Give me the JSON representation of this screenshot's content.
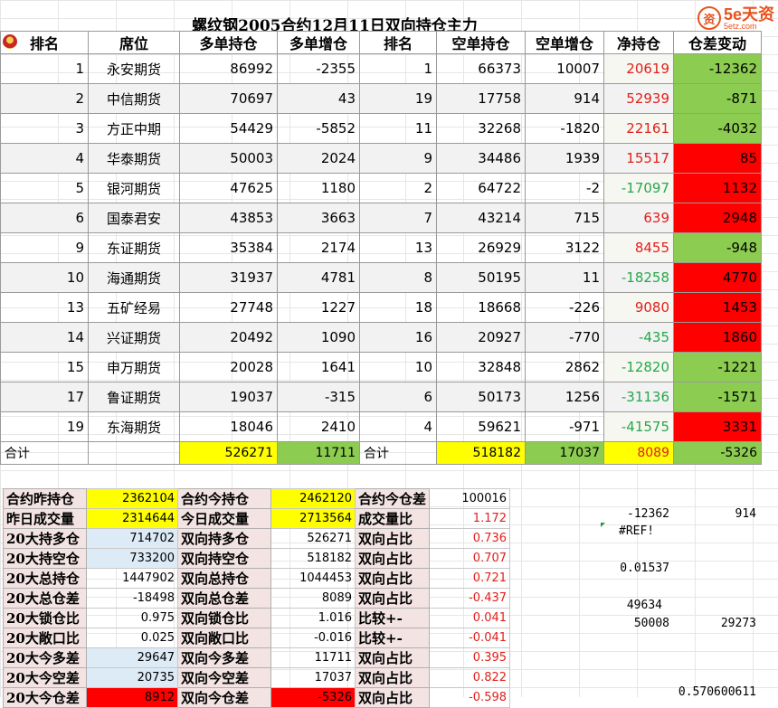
{
  "title": "螺纹钢2005合约12月11日双向持仓主力",
  "logo": {
    "brand": "5e天资",
    "url": "5etz.com"
  },
  "headers": [
    "排名",
    "席位",
    "多单持仓",
    "多单增仓",
    "排名",
    "空单持仓",
    "空单增仓",
    "净持仓",
    "仓差变动"
  ],
  "rows": [
    [
      "1",
      "永安期货",
      "86992",
      "-2355",
      "1",
      "66373",
      "10007",
      "20619",
      "-12362"
    ],
    [
      "2",
      "中信期货",
      "70697",
      "43",
      "19",
      "17758",
      "914",
      "52939",
      "-871"
    ],
    [
      "3",
      "方正中期",
      "54429",
      "-5852",
      "11",
      "32268",
      "-1820",
      "22161",
      "-4032"
    ],
    [
      "4",
      "华泰期货",
      "50003",
      "2024",
      "9",
      "34486",
      "1939",
      "15517",
      "85"
    ],
    [
      "5",
      "银河期货",
      "47625",
      "1180",
      "2",
      "64722",
      "-2",
      "-17097",
      "1132"
    ],
    [
      "6",
      "国泰君安",
      "43853",
      "3663",
      "7",
      "43214",
      "715",
      "639",
      "2948"
    ],
    [
      "9",
      "东证期货",
      "35384",
      "2174",
      "13",
      "26929",
      "3122",
      "8455",
      "-948"
    ],
    [
      "10",
      "海通期货",
      "31937",
      "4781",
      "8",
      "50195",
      "11",
      "-18258",
      "4770"
    ],
    [
      "13",
      "五矿经易",
      "27748",
      "1227",
      "18",
      "18668",
      "-226",
      "9080",
      "1453"
    ],
    [
      "14",
      "兴证期货",
      "20492",
      "1090",
      "16",
      "20927",
      "-770",
      "-435",
      "1860"
    ],
    [
      "15",
      "申万期货",
      "20028",
      "1641",
      "10",
      "32848",
      "2862",
      "-12820",
      "-1221"
    ],
    [
      "17",
      "鲁证期货",
      "19037",
      "-315",
      "6",
      "50173",
      "1256",
      "-31136",
      "-1571"
    ],
    [
      "19",
      "东海期货",
      "18046",
      "2410",
      "4",
      "59621",
      "-971",
      "-41575",
      "3331"
    ]
  ],
  "totals": {
    "label1": "合计",
    "long": "526271",
    "long_inc": "11711",
    "label2": "合计",
    "short": "518182",
    "short_inc": "17037",
    "net": "8089",
    "diff": "-5326"
  },
  "stats": [
    [
      "合约昨持仓",
      "2362104",
      "合约今持仓",
      "2462120",
      "合约今仓差",
      "100016"
    ],
    [
      "昨日成交量",
      "2314644",
      "今日成交量",
      "2713564",
      "成交量比",
      "1.172"
    ],
    [
      "20大持多仓",
      "714702",
      "双向持多仓",
      "526271",
      "双向占比",
      "0.736"
    ],
    [
      "20大持空仓",
      "733200",
      "双向持空仓",
      "518182",
      "双向占比",
      "0.707"
    ],
    [
      "20大总持仓",
      "1447902",
      "双向总持仓",
      "1044453",
      "双向占比",
      "0.721"
    ],
    [
      "20大总仓差",
      "-18498",
      "双向总仓差",
      "8089",
      "双向占比",
      "-0.437"
    ],
    [
      "20大锁仓比",
      "0.975",
      "双向锁仓比",
      "1.016",
      "比较+-",
      "0.041"
    ],
    [
      "20大敞口比",
      "0.025",
      "双向敞口比",
      "-0.016",
      "比较+-",
      "-0.041"
    ],
    [
      "20大今多差",
      "29647",
      "双向今多差",
      "11711",
      "双向占比",
      "0.395"
    ],
    [
      "20大今空差",
      "20735",
      "双向今空差",
      "17037",
      "双向占比",
      "0.822"
    ],
    [
      "20大今仓差",
      "8912",
      "双向今仓差",
      "-5326",
      "双向占比",
      "-0.598"
    ]
  ],
  "side": {
    "v1": "-12362",
    "v2": "914",
    "ref": "#REF!",
    "v3": "0.01537",
    "v4": "49634",
    "v5": "50008",
    "v6": "29273",
    "v7": "0.570600611"
  },
  "colors": {
    "green": "#8ccc50",
    "red": "#ff0000",
    "yellow": "#ffff00",
    "light_blue": "#ddebf7",
    "pink": "#f3e3e3"
  }
}
